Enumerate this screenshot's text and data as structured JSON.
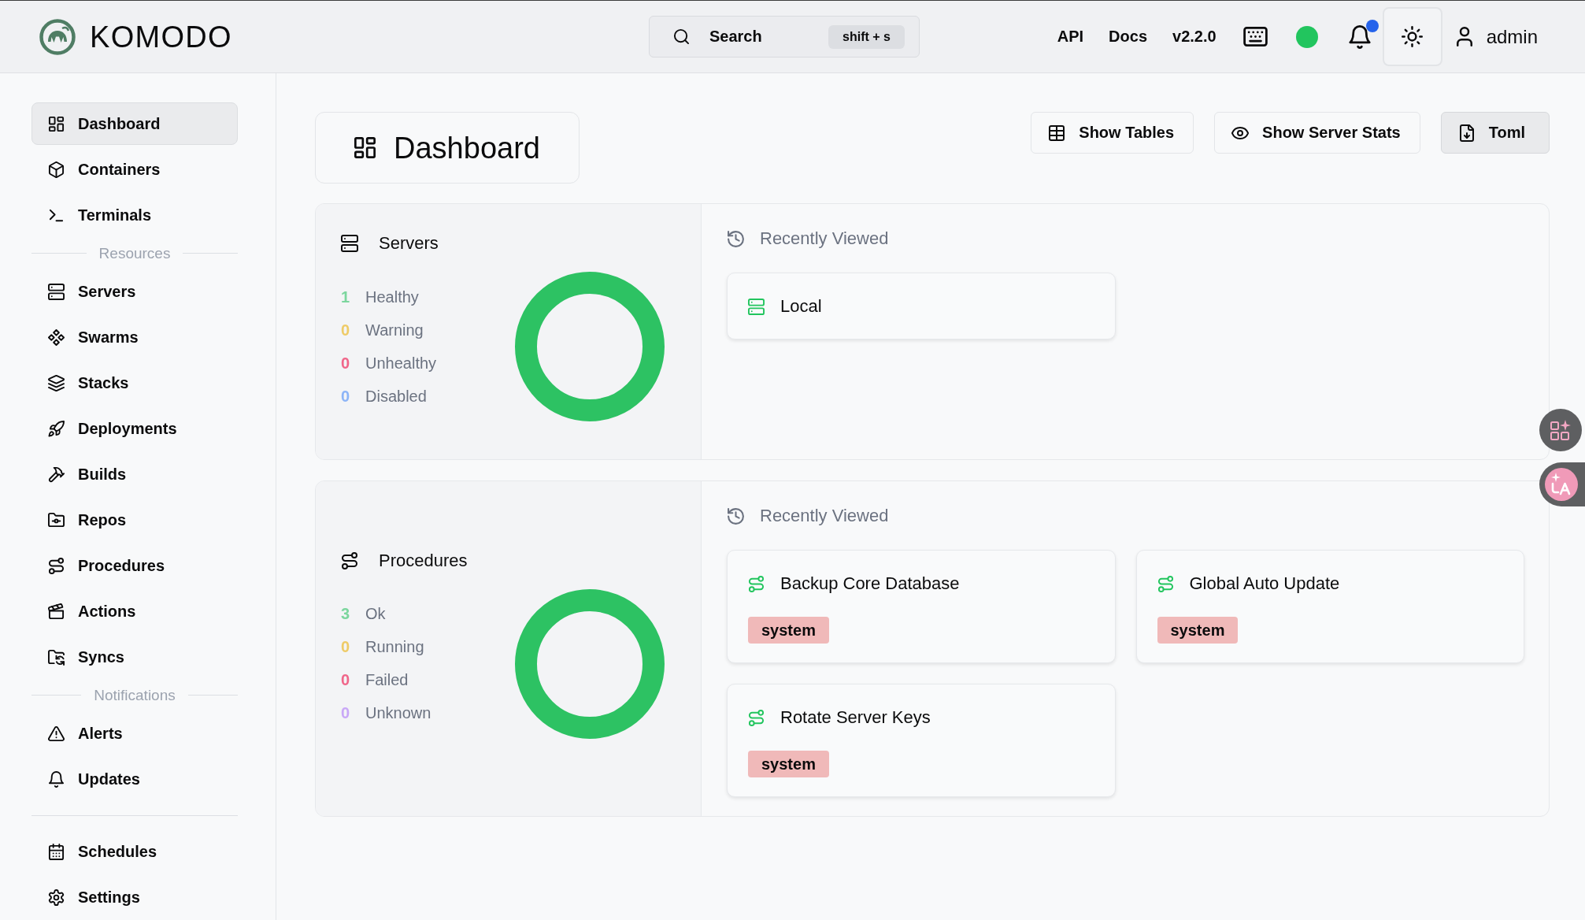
{
  "header": {
    "logo": "KOMODO",
    "search": {
      "label": "Search",
      "shortcut": "shift + s"
    },
    "links": [
      "API",
      "Docs"
    ],
    "version": "v2.2.0",
    "connected": true,
    "unread_notifications": true,
    "user": "admin"
  },
  "sidebar": {
    "groups": [
      {
        "items": [
          {
            "label": "Dashboard",
            "kind": "dashboard",
            "selected": true
          },
          {
            "label": "Containers",
            "kind": "containers",
            "selected": false
          },
          {
            "label": "Terminals",
            "kind": "terminals",
            "selected": false
          }
        ]
      },
      {
        "heading": "Resources",
        "items": [
          {
            "label": "Servers",
            "kind": "servers",
            "selected": false
          },
          {
            "label": "Swarms",
            "kind": "swarms",
            "selected": false
          },
          {
            "label": "Stacks",
            "kind": "stacks",
            "selected": false
          },
          {
            "label": "Deployments",
            "kind": "deployments",
            "selected": false
          },
          {
            "label": "Builds",
            "kind": "builds",
            "selected": false
          },
          {
            "label": "Repos",
            "kind": "repos",
            "selected": false
          },
          {
            "label": "Procedures",
            "kind": "procedures",
            "selected": false
          },
          {
            "label": "Actions",
            "kind": "actions",
            "selected": false
          },
          {
            "label": "Syncs",
            "kind": "syncs",
            "selected": false
          }
        ]
      },
      {
        "heading": "Notifications",
        "items": [
          {
            "label": "Alerts",
            "kind": "alerts",
            "selected": false
          },
          {
            "label": "Updates",
            "kind": "updates",
            "selected": false
          }
        ]
      },
      {
        "items": [
          {
            "label": "Schedules",
            "kind": "schedules",
            "selected": false
          },
          {
            "label": "Settings",
            "kind": "settings",
            "selected": false
          }
        ]
      }
    ]
  },
  "page": {
    "title": "Dashboard",
    "actions": [
      {
        "label": "Show Tables",
        "kind": "tables"
      },
      {
        "label": "Show Server Stats",
        "kind": "stats"
      },
      {
        "label": "Toml",
        "kind": "export"
      }
    ]
  },
  "summaries": [
    {
      "kind": "servers",
      "title": "Servers",
      "stats": [
        {
          "count": "1",
          "label": "Healthy",
          "color": "#7cd69e"
        },
        {
          "count": "0",
          "label": "Warning",
          "color": "#eecb67"
        },
        {
          "count": "0",
          "label": "Unhealthy",
          "color": "#f0668a"
        },
        {
          "count": "0",
          "label": "Disabled",
          "color": "#8cb4f7"
        }
      ],
      "recent": {
        "title": "Recently Viewed",
        "items": [
          {
            "kind": "server",
            "name": "Local"
          }
        ]
      }
    },
    {
      "kind": "procedures",
      "title": "Procedures",
      "stats": [
        {
          "count": "3",
          "label": "Ok",
          "color": "#7cd69e"
        },
        {
          "count": "0",
          "label": "Running",
          "color": "#eecb67"
        },
        {
          "count": "0",
          "label": "Failed",
          "color": "#f0668a"
        },
        {
          "count": "0",
          "label": "Unknown",
          "color": "#c9a8f7"
        }
      ],
      "recent": {
        "title": "Recently Viewed",
        "items": [
          {
            "kind": "procedure",
            "name": "Backup Core Database",
            "tags": [
              "system"
            ]
          },
          {
            "kind": "procedure",
            "name": "Global Auto Update",
            "tags": [
              "system"
            ]
          },
          {
            "kind": "procedure",
            "name": "Rotate Server Keys",
            "tags": [
              "system"
            ]
          }
        ]
      }
    }
  ]
}
